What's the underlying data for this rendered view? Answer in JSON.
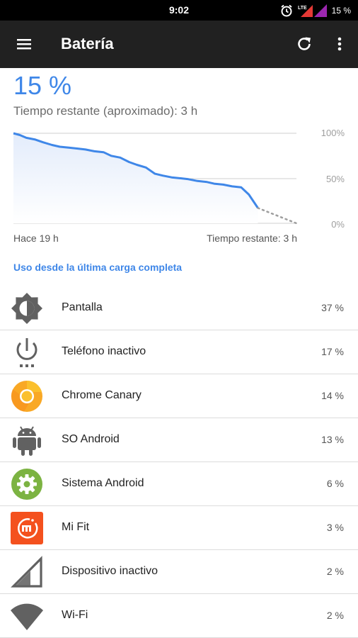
{
  "status_bar": {
    "time": "9:02",
    "network": "LTE",
    "battery_percent": "15 %"
  },
  "app_bar": {
    "title": "Batería",
    "menu_icon": "menu-icon",
    "refresh_icon": "refresh-icon",
    "more_icon": "more-vert-icon"
  },
  "summary": {
    "percent": "15 %",
    "remaining": "Tiempo restante (aproximado): 3 h"
  },
  "chart_data": {
    "type": "area",
    "ylim": [
      0,
      100
    ],
    "y_tick_labels": [
      "100%",
      "50%",
      "0%"
    ],
    "x_start_label": "Hace 19 h",
    "x_end_label": "Tiempo restante: 3 h",
    "x_range_hours": [
      -19,
      3
    ],
    "series": [
      {
        "name": "",
        "style": "solid",
        "points": [
          [
            -19,
            100
          ],
          [
            -18.5,
            98
          ],
          [
            -18,
            95
          ],
          [
            -17.3,
            93
          ],
          [
            -16.7,
            90
          ],
          [
            -16,
            87
          ],
          [
            -15.4,
            85
          ],
          [
            -14.7,
            84
          ],
          [
            -14,
            83
          ],
          [
            -13.4,
            82
          ],
          [
            -12.7,
            80
          ],
          [
            -12,
            79
          ],
          [
            -11.4,
            75
          ],
          [
            -10.7,
            73
          ],
          [
            -10,
            68
          ],
          [
            -9.4,
            65
          ],
          [
            -8.7,
            62
          ],
          [
            -8,
            55
          ],
          [
            -7.4,
            53
          ],
          [
            -6.7,
            51
          ],
          [
            -6,
            50
          ],
          [
            -5.4,
            49
          ],
          [
            -4.7,
            47
          ],
          [
            -4,
            46
          ],
          [
            -3.4,
            44
          ],
          [
            -2.7,
            43
          ],
          [
            -2,
            41
          ],
          [
            -1.3,
            40
          ],
          [
            -0.7,
            32
          ],
          [
            0,
            17
          ]
        ]
      },
      {
        "name": "",
        "style": "dotted",
        "points": [
          [
            0,
            17
          ],
          [
            3,
            0
          ]
        ]
      }
    ]
  },
  "chart_labels": {
    "y_top": "100%",
    "y_mid": "50%",
    "y_bottom": "0%",
    "x_left": "Hace 19 h",
    "x_right": "Tiempo restante: 3 h"
  },
  "section_title": "Uso desde la última carga completa",
  "usage": [
    {
      "name": "Pantalla",
      "value": "37 %",
      "icon": "brightness-icon"
    },
    {
      "name": "Teléfono inactivo",
      "value": "17 %",
      "icon": "power-icon"
    },
    {
      "name": "Chrome Canary",
      "value": "14 %",
      "icon": "chrome-canary-icon"
    },
    {
      "name": "SO Android",
      "value": "13 %",
      "icon": "android-icon"
    },
    {
      "name": "Sistema Android",
      "value": "6 %",
      "icon": "settings-icon"
    },
    {
      "name": "Mi Fit",
      "value": "3 %",
      "icon": "mi-fit-icon"
    },
    {
      "name": "Dispositivo inactivo",
      "value": "2 %",
      "icon": "cell-signal-icon"
    },
    {
      "name": "Wi-Fi",
      "value": "2 %",
      "icon": "wifi-icon"
    }
  ],
  "colors": {
    "accent": "#3f87e8",
    "toolbar": "#212121",
    "chart_fill": "#e3ecfb",
    "icon_gray": "#616161",
    "mi_fit_orange": "#f4511e",
    "settings_green": "#7cb342",
    "canary_yellow": "#f9a825"
  }
}
